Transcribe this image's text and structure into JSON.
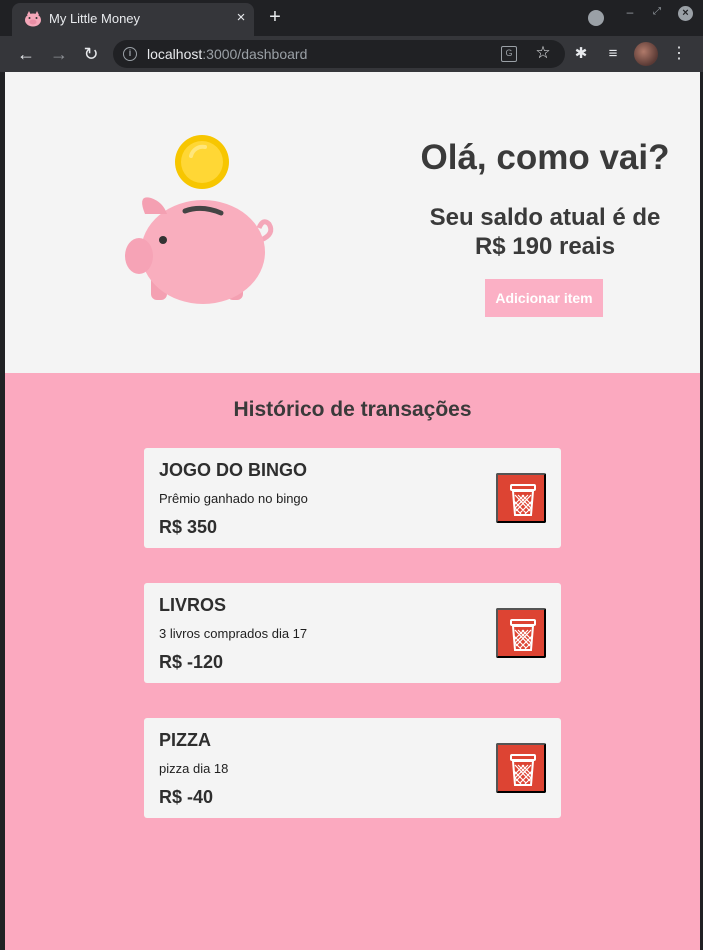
{
  "browser": {
    "tab_title": "My Little Money",
    "tab_close": "×",
    "new_tab": "+",
    "url_host": "localhost",
    "url_path": ":3000/dashboard",
    "icons": {
      "favicon": "pig-icon",
      "back": "arrow-left-icon",
      "forward": "arrow-right-icon",
      "reload": "reload-icon",
      "info": "info-icon",
      "translate": "translate-icon",
      "bookmark": "star-icon",
      "extensions": "puzzle-icon",
      "media": "media-control-icon",
      "menu": "kebab-menu-icon"
    }
  },
  "hero": {
    "greeting": "Olá, como vai?",
    "balance_line1": "Seu saldo atual é de",
    "balance_line2": "R$ 190 reais",
    "add_button": "Adicionar item",
    "illustration": "piggy-bank-coin-icon"
  },
  "history": {
    "title": "Histórico de transações",
    "transactions": [
      {
        "title": "JOGO DO BINGO",
        "description": "Prêmio ganhado no bingo",
        "amount": "R$ 350"
      },
      {
        "title": "LIVROS",
        "description": "3 livros comprados dia 17",
        "amount": "R$ -120"
      },
      {
        "title": "PIZZA",
        "description": "pizza dia 18",
        "amount": "R$ -40"
      }
    ],
    "delete_icon": "trash-icon"
  },
  "colors": {
    "page_background": "#fba9bf",
    "hero_background": "#f4f4f4",
    "card_background": "#f4f4f4",
    "add_button": "#fbb0c5",
    "delete_button": "#dd4433",
    "text": "#3a3a3a"
  }
}
